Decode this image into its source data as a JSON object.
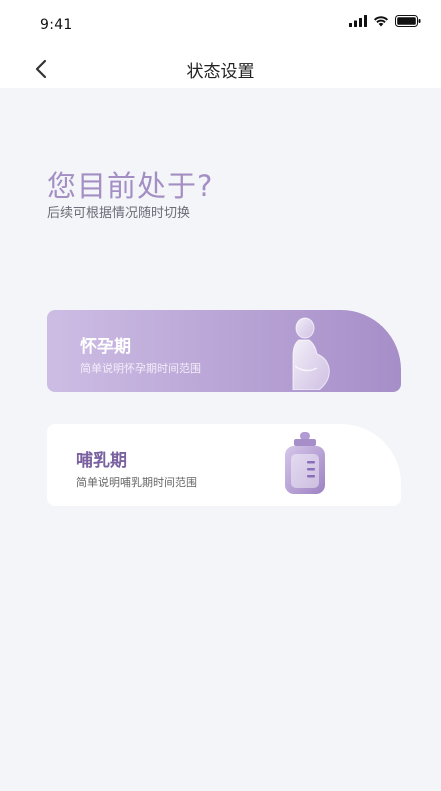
{
  "status_bar": {
    "time": "9:41",
    "icons": [
      "signal-icon",
      "wifi-icon",
      "battery-icon"
    ]
  },
  "nav": {
    "back_icon": "chevron-left-icon",
    "title": "状态设置"
  },
  "prompt": {
    "heading": "您目前处于?",
    "subheading": "后续可根据情况随时切换"
  },
  "options": [
    {
      "title": "怀孕期",
      "description": "简单说明怀孕期时间范围",
      "icon": "pregnant-woman-icon",
      "selected": true
    },
    {
      "title": "哺乳期",
      "description": "简单说明哺乳期时间范围",
      "icon": "baby-bottle-icon",
      "selected": false
    }
  ],
  "colors": {
    "accent": "#a48fc4",
    "selected_card_start": "#cdbde4",
    "selected_card_end": "#a68ec8",
    "background": "#f4f5f9"
  }
}
